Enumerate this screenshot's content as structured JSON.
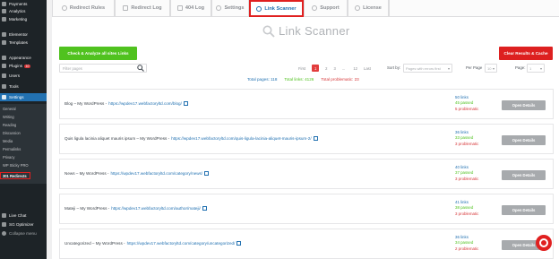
{
  "sidebar": {
    "items": [
      {
        "label": "Payments",
        "top": 0
      },
      {
        "label": "Analytics"
      },
      {
        "label": "Marketing"
      },
      {
        "label": "Elementor"
      },
      {
        "label": "Templates"
      },
      {
        "label": "Appearance"
      },
      {
        "label": "Plugins",
        "badge": "10"
      },
      {
        "label": "Users"
      },
      {
        "label": "Tools"
      },
      {
        "label": "Settings"
      }
    ],
    "submenu": [
      "General",
      "Writing",
      "Reading",
      "Discussion",
      "Media",
      "Permalinks",
      "Privacy",
      "WP Sticky PRO",
      "301 Redirects"
    ],
    "bottom": [
      "Live Chat",
      "SG Optimizer",
      "Collapse menu"
    ]
  },
  "tabs": [
    "Redirect Rules",
    "Redirect Log",
    "404 Log",
    "Settings",
    "Link Scanner",
    "Support",
    "License"
  ],
  "title": "Link Scanner",
  "buttons": {
    "check": "Check & Analyze all sites Links",
    "clear": "Clear Results & Cache",
    "open": "Open Details"
  },
  "filter": {
    "placeholder": "Filter pages"
  },
  "pager": {
    "first": "First",
    "pages": [
      "2",
      "3"
    ],
    "current": "1",
    "ellipsis": "...",
    "last_page": "12",
    "last": "Last"
  },
  "controls": {
    "sort_label": "Sort by:",
    "sort_value": "Pages with errors first",
    "perpage_label": "Per Page",
    "perpage_value": "10",
    "page_label": "Page:",
    "page_value": "1"
  },
  "totals": {
    "pages": "Total pages: 118",
    "links": "Total links: 4126",
    "problematic": "Total problematic: 23"
  },
  "rows": [
    {
      "title": "Blog – My WordPress -",
      "url": "https://wpdev17.webfactoryltd.com/blog/",
      "links": "50 links",
      "passed": "45 passed",
      "problematic": "5 problematic"
    },
    {
      "title": "Quis ligula lacinia aliquet mauris ipsum – My WordPress -",
      "url": "https://wpdev17.webfactoryltd.com/quis-ligula-lacinia-aliquet-mauris-ipsum-2/",
      "links": "36 links",
      "passed": "33 passed",
      "problematic": "3 problematic"
    },
    {
      "title": "News – My WordPress -",
      "url": "https://wpdev17.webfactoryltd.com/category/news/",
      "links": "40 links",
      "passed": "37 passed",
      "problematic": "3 problematic"
    },
    {
      "title": "Mateji – My WordPress -",
      "url": "https://wpdev17.webfactoryltd.com/author/mateji/",
      "links": "41 links",
      "passed": "38 passed",
      "problematic": "3 problematic"
    },
    {
      "title": "Uncategorized – My WordPress -",
      "url": "https://wpdev17.webfactoryltd.com/category/uncategorized/",
      "links": "36 links",
      "passed": "34 passed",
      "problematic": "2 problematic"
    }
  ],
  "colors": {
    "accent": "#2271b1",
    "danger": "#e02020",
    "success": "#50c21f"
  }
}
